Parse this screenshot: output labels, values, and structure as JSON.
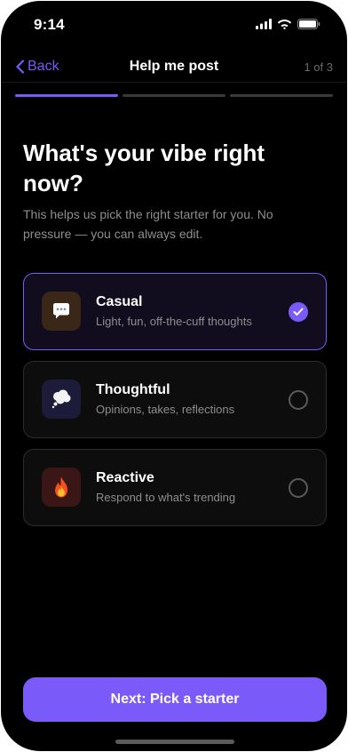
{
  "status_bar": {
    "time": "9:14"
  },
  "nav": {
    "back_label": "Back",
    "title": "Help me post",
    "step": "1 of 3"
  },
  "progress": {
    "total_steps": 3,
    "current_step": 1
  },
  "headline": "What's your vibe right now?",
  "subtitle": "This helps us pick the right starter for you. No pressure — you can always edit.",
  "options": [
    {
      "title": "Casual",
      "description": "Light, fun, off-the-cuff thoughts",
      "icon": "speech-bubble-icon",
      "selected": true
    },
    {
      "title": "Thoughtful",
      "description": "Opinions, takes, reflections",
      "icon": "thought-bubble-icon",
      "selected": false
    },
    {
      "title": "Reactive",
      "description": "Respond to what's trending",
      "icon": "fire-icon",
      "selected": false
    }
  ],
  "cta_label": "Next: Pick a starter",
  "colors": {
    "accent": "#7a5af8",
    "background": "#000000"
  }
}
